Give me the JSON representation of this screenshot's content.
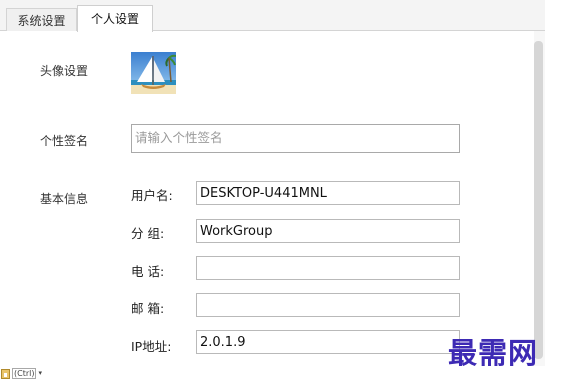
{
  "tabs": [
    {
      "label": "系统设置",
      "active": false
    },
    {
      "label": "个人设置",
      "active": true
    }
  ],
  "avatar_section": {
    "label": "头像设置",
    "avatar_icon": "sailboat-beach-avatar"
  },
  "signature_section": {
    "label": "个性签名",
    "placeholder": "请输入个性签名",
    "value": ""
  },
  "basic_info": {
    "label": "基本信息",
    "fields": [
      {
        "label": "用户名:",
        "value": "DESKTOP-U441MNL"
      },
      {
        "label": "分 组:",
        "value": "WorkGroup"
      },
      {
        "label": "电 话:",
        "value": ""
      },
      {
        "label": "邮 箱:",
        "value": ""
      },
      {
        "label": "IP地址:",
        "value": "2.0.1.9"
      }
    ]
  },
  "watermark": "最需网",
  "paste_hint": {
    "text": "(Ctrl)",
    "icon": "clipboard-icon",
    "dropdown_icon": "chevron-down-icon"
  },
  "colors": {
    "watermark": "#3d2ab4",
    "input_border": "#b9b9b9",
    "tab_strip": "#f4f4f4"
  }
}
